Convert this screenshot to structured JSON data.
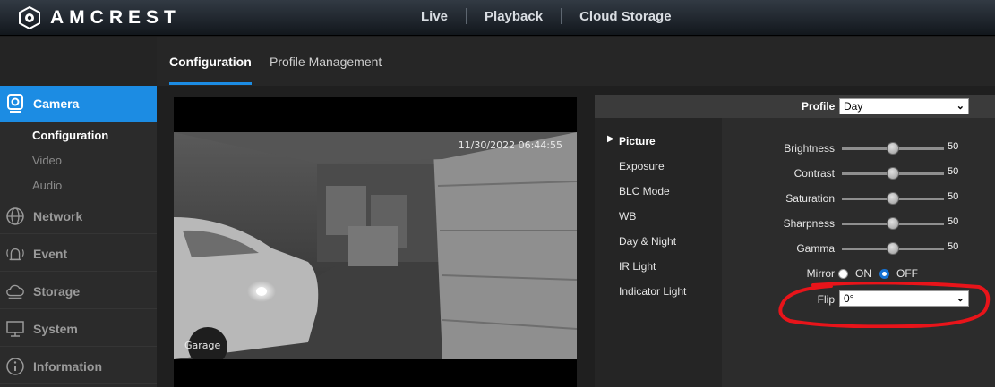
{
  "brand": {
    "name": "AMCREST"
  },
  "topnav": {
    "items": [
      "Live",
      "Playback",
      "Cloud Storage"
    ]
  },
  "tabs": {
    "items": [
      "Configuration",
      "Profile Management"
    ]
  },
  "sidebar": {
    "camera": "Camera",
    "sub_items": [
      "Configuration",
      "Video",
      "Audio"
    ],
    "items": [
      "Network",
      "Event",
      "Storage",
      "System",
      "Information"
    ]
  },
  "video": {
    "timestamp": "11/30/2022 06:44:55",
    "name": "Garage"
  },
  "panel": {
    "profile_label": "Profile",
    "profile_value": "Day",
    "menu": [
      "Picture",
      "Exposure",
      "BLC Mode",
      "WB",
      "Day & Night",
      "IR Light",
      "Indicator Light"
    ],
    "sliders": [
      {
        "label": "Brightness",
        "value": 50
      },
      {
        "label": "Contrast",
        "value": 50
      },
      {
        "label": "Saturation",
        "value": 50
      },
      {
        "label": "Sharpness",
        "value": 50
      },
      {
        "label": "Gamma",
        "value": 50
      }
    ],
    "mirror": {
      "label": "Mirror",
      "on": "ON",
      "off": "OFF",
      "selected": "OFF"
    },
    "flip": {
      "label": "Flip",
      "value": "0°"
    }
  },
  "colors": {
    "accent": "#1c8ce3",
    "annotation": "#e8141a"
  }
}
